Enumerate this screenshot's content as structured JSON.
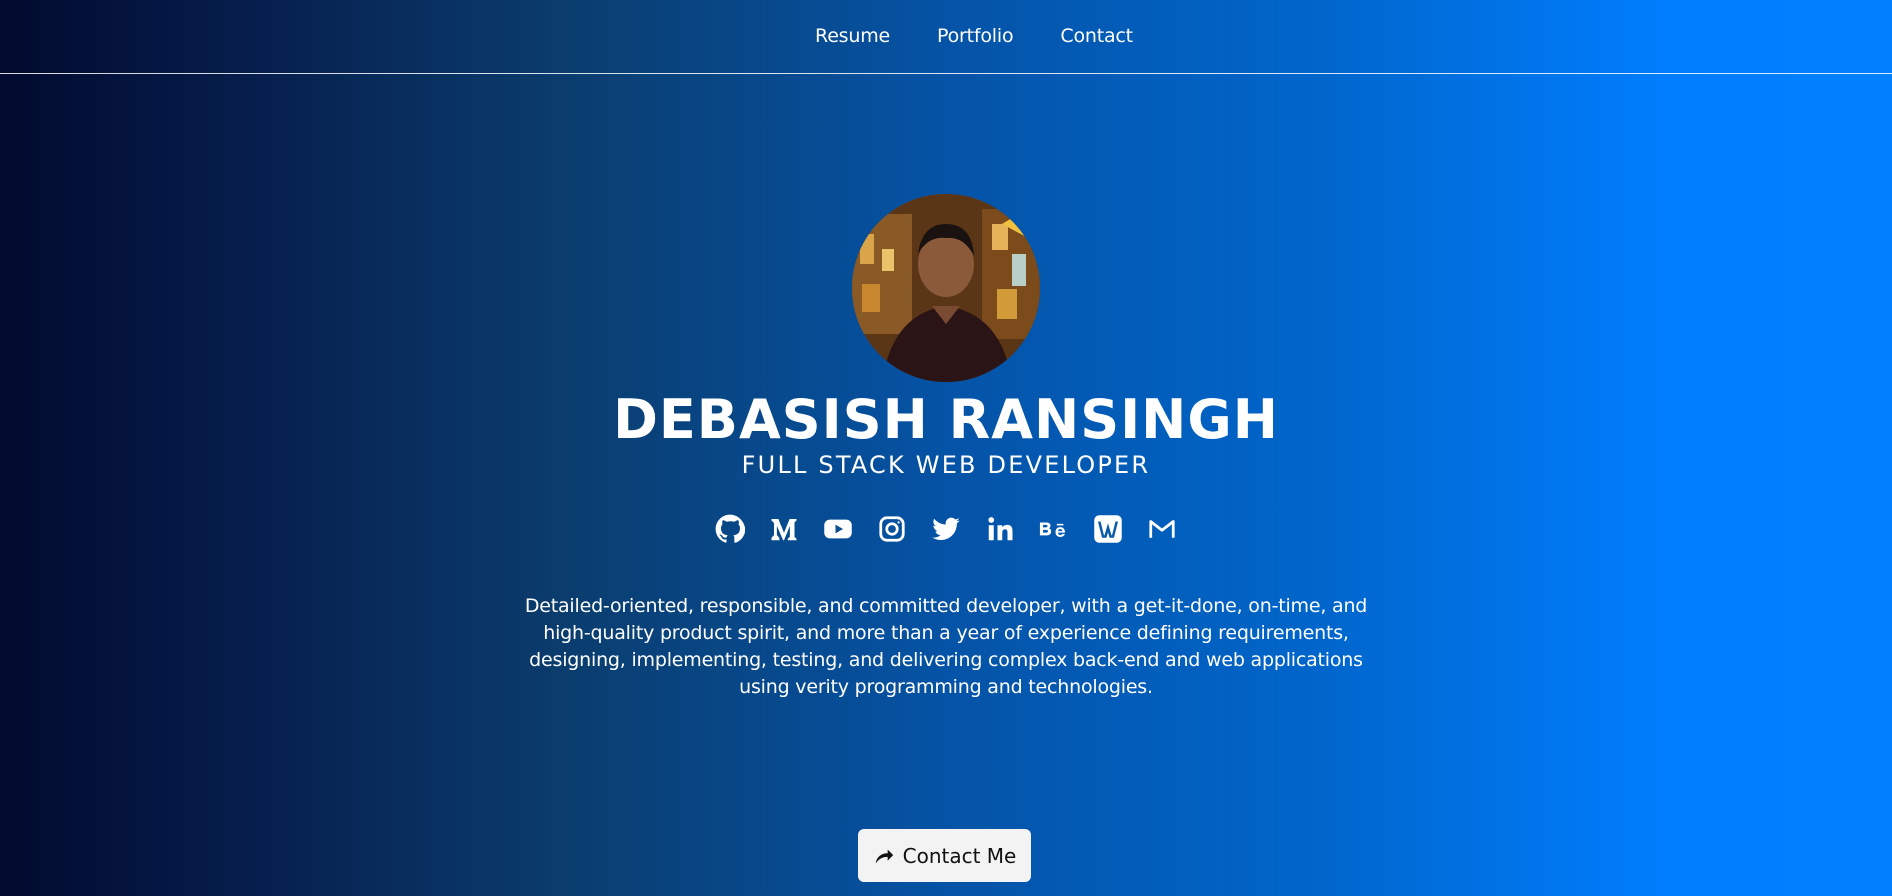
{
  "nav": {
    "items": [
      {
        "label": "Resume"
      },
      {
        "label": "Portfolio"
      },
      {
        "label": "Contact"
      }
    ]
  },
  "profile": {
    "name": "DEBASISH RANSINGH",
    "role": "FULL STACK WEB DEVELOPER",
    "bio": "Detailed-oriented, responsible, and committed developer, with a get-it-done, on-time, and high-quality product spirit, and more than a year of experience defining requirements, designing, implementing, testing, and delivering complex back-end and web applications using verity programming and technologies."
  },
  "socials": [
    {
      "icon": "github-icon"
    },
    {
      "icon": "medium-icon"
    },
    {
      "icon": "youtube-icon"
    },
    {
      "icon": "instagram-icon"
    },
    {
      "icon": "twitter-icon"
    },
    {
      "icon": "linkedin-icon"
    },
    {
      "icon": "behance-icon"
    },
    {
      "icon": "wellfound-icon"
    },
    {
      "icon": "gmail-icon"
    }
  ],
  "cta": {
    "label": "Contact Me",
    "icon": "share-arrow-icon"
  },
  "colors": {
    "gradient_left": "#020a2e",
    "gradient_right": "#0080ff",
    "button_bg": "#f3f3f3",
    "text": "#ffffff"
  }
}
